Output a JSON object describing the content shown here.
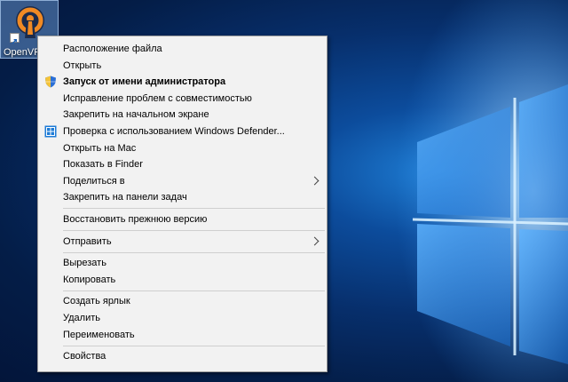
{
  "desktop": {
    "icon_label": "OpenVPN",
    "icon_name": "openvpn-icon"
  },
  "context_menu": {
    "groups": [
      [
        {
          "label": "Расположение файла",
          "icon": "",
          "bold": false,
          "submenu": false
        },
        {
          "label": "Открыть",
          "icon": "",
          "bold": false,
          "submenu": false
        },
        {
          "label": "Запуск от имени администратора",
          "icon": "uac-shield-icon",
          "bold": true,
          "submenu": false
        },
        {
          "label": "Исправление проблем с совместимостью",
          "icon": "",
          "bold": false,
          "submenu": false
        },
        {
          "label": "Закрепить на начальном экране",
          "icon": "",
          "bold": false,
          "submenu": false
        },
        {
          "label": "Проверка с использованием Windows Defender...",
          "icon": "windows-defender-icon",
          "bold": false,
          "submenu": false
        },
        {
          "label": "Открыть на Mac",
          "icon": "",
          "bold": false,
          "submenu": false
        },
        {
          "label": "Показать в Finder",
          "icon": "",
          "bold": false,
          "submenu": false
        },
        {
          "label": "Поделиться в",
          "icon": "",
          "bold": false,
          "submenu": true
        },
        {
          "label": "Закрепить на панели задач",
          "icon": "",
          "bold": false,
          "submenu": false
        }
      ],
      [
        {
          "label": "Восстановить прежнюю версию",
          "icon": "",
          "bold": false,
          "submenu": false
        }
      ],
      [
        {
          "label": "Отправить",
          "icon": "",
          "bold": false,
          "submenu": true
        }
      ],
      [
        {
          "label": "Вырезать",
          "icon": "",
          "bold": false,
          "submenu": false
        },
        {
          "label": "Копировать",
          "icon": "",
          "bold": false,
          "submenu": false
        }
      ],
      [
        {
          "label": "Создать ярлык",
          "icon": "",
          "bold": false,
          "submenu": false
        },
        {
          "label": "Удалить",
          "icon": "",
          "bold": false,
          "submenu": false
        },
        {
          "label": "Переименовать",
          "icon": "",
          "bold": false,
          "submenu": false
        }
      ],
      [
        {
          "label": "Свойства",
          "icon": "",
          "bold": false,
          "submenu": false
        }
      ]
    ]
  },
  "colors": {
    "menu_bg": "#f2f2f2",
    "separator": "#cfcfcf",
    "openvpn_orange": "#f08a24",
    "openvpn_navy": "#1b2b4c"
  }
}
